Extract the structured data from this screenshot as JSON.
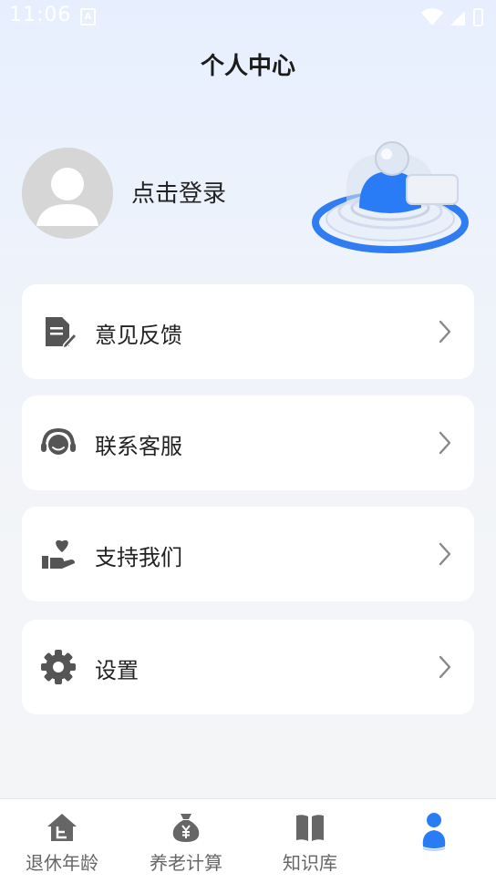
{
  "status_bar": {
    "time": "11:06"
  },
  "header": {
    "title": "个人中心"
  },
  "profile": {
    "login_label": "点击登录"
  },
  "menu": [
    {
      "label": "意见反馈",
      "icon": "feedback-document-icon"
    },
    {
      "label": "联系客服",
      "icon": "headset-icon"
    },
    {
      "label": "支持我们",
      "icon": "hand-heart-icon"
    },
    {
      "label": "设置",
      "icon": "gear-icon"
    }
  ],
  "tabs": [
    {
      "label": "退休年龄",
      "icon": "house-icon"
    },
    {
      "label": "养老计算",
      "icon": "money-bag-icon"
    },
    {
      "label": "知识库",
      "icon": "book-icon"
    },
    {
      "label": "",
      "icon": "person-icon",
      "active": true
    }
  ],
  "colors": {
    "accent": "#2a7cf6",
    "icon_gray": "#555555",
    "text": "#222222"
  }
}
